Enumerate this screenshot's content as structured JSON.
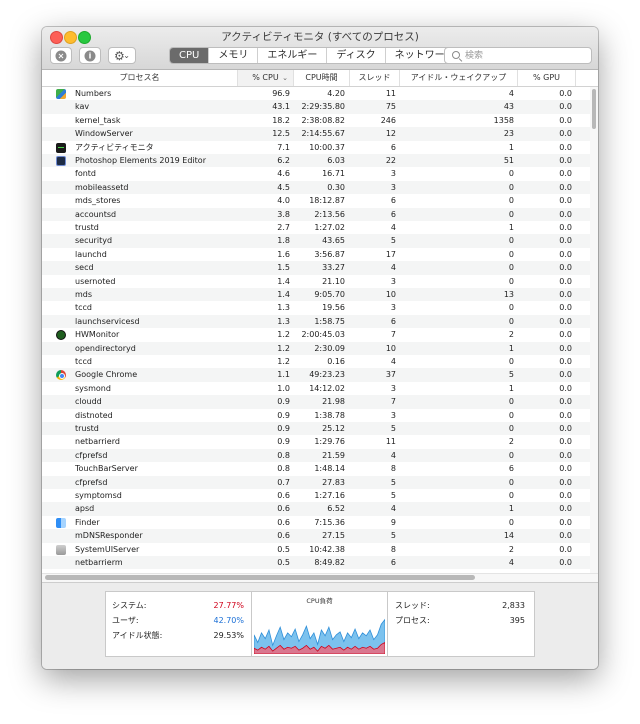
{
  "window": {
    "title": "アクティビティモニタ (すべてのプロセス)"
  },
  "tabs": [
    {
      "label": "CPU",
      "active": true
    },
    {
      "label": "メモリ",
      "active": false
    },
    {
      "label": "エネルギー",
      "active": false
    },
    {
      "label": "ディスク",
      "active": false
    },
    {
      "label": "ネットワーク",
      "active": false
    }
  ],
  "search": {
    "placeholder": "検索",
    "value": ""
  },
  "columns": {
    "name": "プロセス名",
    "cpu": "% CPU",
    "cpu_time": "CPU時間",
    "threads": "スレッド",
    "idle_wakeups": "アイドル・ウェイクアップ",
    "gpu": "% GPU"
  },
  "processes": [
    {
      "name": "Numbers",
      "icon": "numbers-app-icon",
      "cpu": "96.9",
      "time": "4.20",
      "threads": "11",
      "wakeups": "4",
      "gpu": "0.0"
    },
    {
      "name": "kav",
      "icon": "",
      "cpu": "43.1",
      "time": "2:29:35.80",
      "threads": "75",
      "wakeups": "43",
      "gpu": "0.0"
    },
    {
      "name": "kernel_task",
      "icon": "",
      "cpu": "18.2",
      "time": "2:38:08.82",
      "threads": "246",
      "wakeups": "1358",
      "gpu": "0.0"
    },
    {
      "name": "WindowServer",
      "icon": "",
      "cpu": "12.5",
      "time": "2:14:55.67",
      "threads": "12",
      "wakeups": "23",
      "gpu": "0.0"
    },
    {
      "name": "アクティビティモニタ",
      "icon": "activity-monitor-icon",
      "cpu": "7.1",
      "time": "10:00.37",
      "threads": "6",
      "wakeups": "1",
      "gpu": "0.0"
    },
    {
      "name": "Photoshop Elements 2019 Editor",
      "icon": "photoshop-elements-icon",
      "cpu": "6.2",
      "time": "6.03",
      "threads": "22",
      "wakeups": "51",
      "gpu": "0.0"
    },
    {
      "name": "fontd",
      "icon": "",
      "cpu": "4.6",
      "time": "16.71",
      "threads": "3",
      "wakeups": "0",
      "gpu": "0.0"
    },
    {
      "name": "mobileassetd",
      "icon": "",
      "cpu": "4.5",
      "time": "0.30",
      "threads": "3",
      "wakeups": "0",
      "gpu": "0.0"
    },
    {
      "name": "mds_stores",
      "icon": "",
      "cpu": "4.0",
      "time": "18:12.87",
      "threads": "6",
      "wakeups": "0",
      "gpu": "0.0"
    },
    {
      "name": "accountsd",
      "icon": "",
      "cpu": "3.8",
      "time": "2:13.56",
      "threads": "6",
      "wakeups": "0",
      "gpu": "0.0"
    },
    {
      "name": "trustd",
      "icon": "",
      "cpu": "2.7",
      "time": "1:27.02",
      "threads": "4",
      "wakeups": "1",
      "gpu": "0.0"
    },
    {
      "name": "securityd",
      "icon": "",
      "cpu": "1.8",
      "time": "43.65",
      "threads": "5",
      "wakeups": "0",
      "gpu": "0.0"
    },
    {
      "name": "launchd",
      "icon": "",
      "cpu": "1.6",
      "time": "3:56.87",
      "threads": "17",
      "wakeups": "0",
      "gpu": "0.0"
    },
    {
      "name": "secd",
      "icon": "",
      "cpu": "1.5",
      "time": "33.27",
      "threads": "4",
      "wakeups": "0",
      "gpu": "0.0"
    },
    {
      "name": "usernoted",
      "icon": "",
      "cpu": "1.4",
      "time": "21.10",
      "threads": "3",
      "wakeups": "0",
      "gpu": "0.0"
    },
    {
      "name": "mds",
      "icon": "",
      "cpu": "1.4",
      "time": "9:05.70",
      "threads": "10",
      "wakeups": "13",
      "gpu": "0.0"
    },
    {
      "name": "tccd",
      "icon": "",
      "cpu": "1.3",
      "time": "19.56",
      "threads": "3",
      "wakeups": "0",
      "gpu": "0.0"
    },
    {
      "name": "launchservicesd",
      "icon": "",
      "cpu": "1.3",
      "time": "1:58.75",
      "threads": "6",
      "wakeups": "0",
      "gpu": "0.0"
    },
    {
      "name": "HWMonitor",
      "icon": "hwmonitor-icon",
      "cpu": "1.2",
      "time": "2:00:45.03",
      "threads": "7",
      "wakeups": "2",
      "gpu": "0.0"
    },
    {
      "name": "opendirectoryd",
      "icon": "",
      "cpu": "1.2",
      "time": "2:30.09",
      "threads": "10",
      "wakeups": "1",
      "gpu": "0.0"
    },
    {
      "name": "tccd",
      "icon": "",
      "cpu": "1.2",
      "time": "0.16",
      "threads": "4",
      "wakeups": "0",
      "gpu": "0.0"
    },
    {
      "name": "Google Chrome",
      "icon": "chrome-icon",
      "cpu": "1.1",
      "time": "49:23.23",
      "threads": "37",
      "wakeups": "5",
      "gpu": "0.0"
    },
    {
      "name": "sysmond",
      "icon": "",
      "cpu": "1.0",
      "time": "14:12.02",
      "threads": "3",
      "wakeups": "1",
      "gpu": "0.0"
    },
    {
      "name": "cloudd",
      "icon": "",
      "cpu": "0.9",
      "time": "21.98",
      "threads": "7",
      "wakeups": "0",
      "gpu": "0.0"
    },
    {
      "name": "distnoted",
      "icon": "",
      "cpu": "0.9",
      "time": "1:38.78",
      "threads": "3",
      "wakeups": "0",
      "gpu": "0.0"
    },
    {
      "name": "trustd",
      "icon": "",
      "cpu": "0.9",
      "time": "25.12",
      "threads": "5",
      "wakeups": "0",
      "gpu": "0.0"
    },
    {
      "name": "netbarrierd",
      "icon": "",
      "cpu": "0.9",
      "time": "1:29.76",
      "threads": "11",
      "wakeups": "2",
      "gpu": "0.0"
    },
    {
      "name": "cfprefsd",
      "icon": "",
      "cpu": "0.8",
      "time": "21.59",
      "threads": "4",
      "wakeups": "0",
      "gpu": "0.0"
    },
    {
      "name": "TouchBarServer",
      "icon": "",
      "cpu": "0.8",
      "time": "1:48.14",
      "threads": "8",
      "wakeups": "6",
      "gpu": "0.0"
    },
    {
      "name": "cfprefsd",
      "icon": "",
      "cpu": "0.7",
      "time": "27.83",
      "threads": "5",
      "wakeups": "0",
      "gpu": "0.0"
    },
    {
      "name": "symptomsd",
      "icon": "",
      "cpu": "0.6",
      "time": "1:27.16",
      "threads": "5",
      "wakeups": "0",
      "gpu": "0.0"
    },
    {
      "name": "apsd",
      "icon": "",
      "cpu": "0.6",
      "time": "6.52",
      "threads": "4",
      "wakeups": "1",
      "gpu": "0.0"
    },
    {
      "name": "Finder",
      "icon": "finder-icon",
      "cpu": "0.6",
      "time": "7:15.36",
      "threads": "9",
      "wakeups": "0",
      "gpu": "0.0"
    },
    {
      "name": "mDNSResponder",
      "icon": "",
      "cpu": "0.6",
      "time": "27.15",
      "threads": "5",
      "wakeups": "14",
      "gpu": "0.0"
    },
    {
      "name": "SystemUIServer",
      "icon": "systemuiserver-icon",
      "cpu": "0.5",
      "time": "10:42.38",
      "threads": "8",
      "wakeups": "2",
      "gpu": "0.0"
    },
    {
      "name": "netbarrierm",
      "icon": "",
      "cpu": "0.5",
      "time": "8:49.82",
      "threads": "6",
      "wakeups": "4",
      "gpu": "0.0"
    }
  ],
  "footer": {
    "system_label": "システム:",
    "system_value": "27.77%",
    "system_color": "#d0021b",
    "user_label": "ユーザ:",
    "user_value": "42.70%",
    "user_color": "#1a6fd6",
    "idle_label": "アイドル状態:",
    "idle_value": "29.53%",
    "graph_title": "CPU負荷",
    "threads_label": "スレッド:",
    "threads_value": "2,833",
    "processes_label": "プロセス:",
    "processes_value": "395"
  },
  "cpu_history": {
    "user": [
      28,
      16,
      30,
      22,
      34,
      12,
      26,
      38,
      20,
      30,
      24,
      36,
      18,
      28,
      40,
      22,
      30,
      14,
      34,
      26,
      38,
      20,
      28,
      32,
      18,
      30,
      24,
      36,
      22,
      30,
      26,
      34,
      20,
      28,
      42,
      48
    ],
    "system": [
      12,
      8,
      14,
      10,
      16,
      6,
      12,
      18,
      10,
      14,
      12,
      16,
      8,
      12,
      18,
      10,
      14,
      6,
      16,
      12,
      18,
      10,
      12,
      14,
      8,
      14,
      10,
      16,
      10,
      14,
      12,
      16,
      10,
      12,
      20,
      24
    ]
  }
}
